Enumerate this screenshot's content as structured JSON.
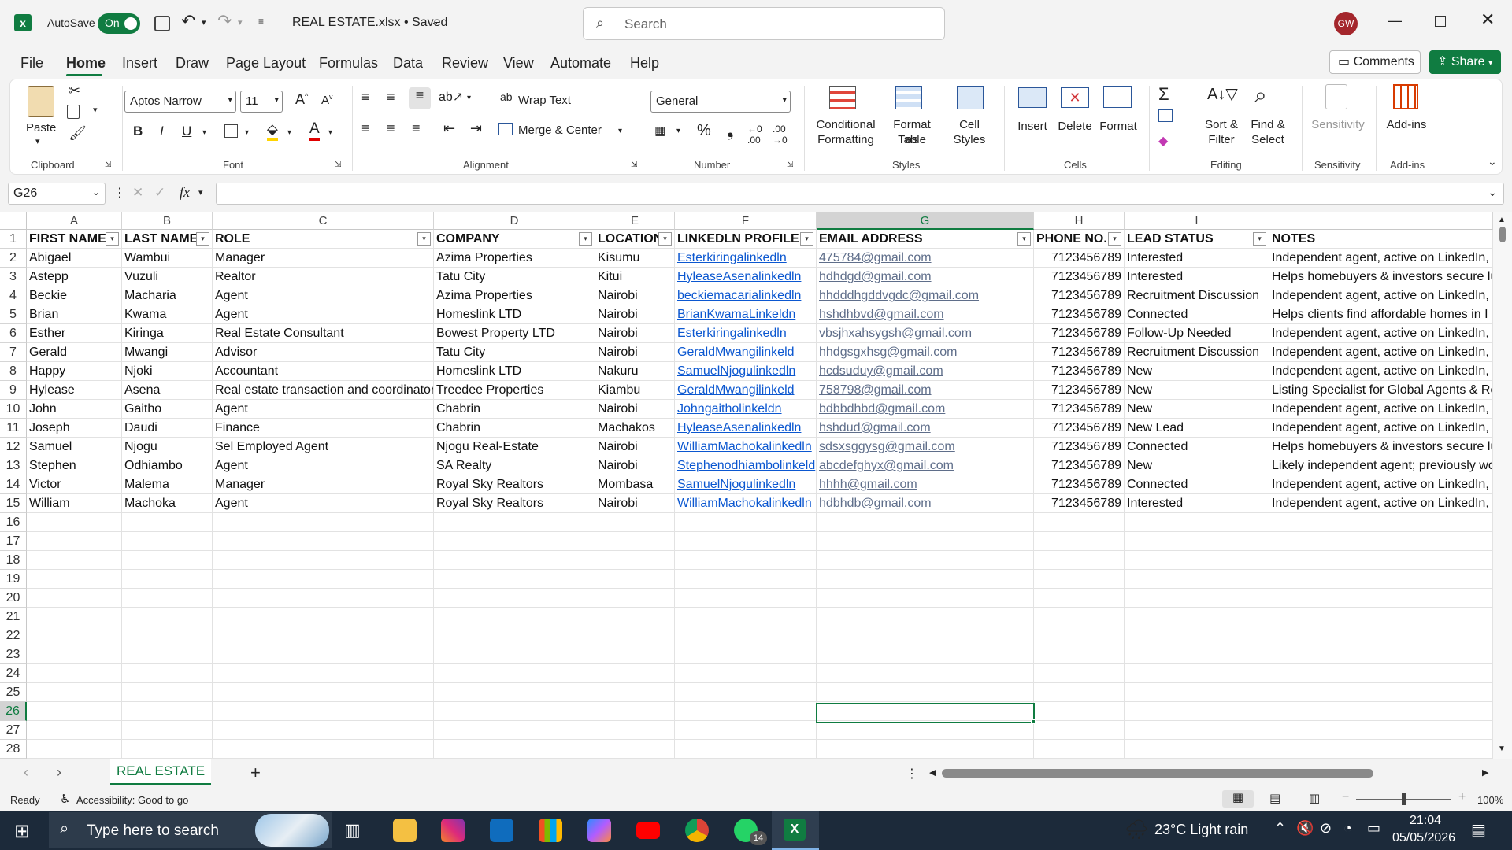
{
  "titlebar": {
    "autosave_label": "AutoSave",
    "autosave_state": "On",
    "filename": "REAL ESTATE.xlsx • Saved",
    "search_placeholder": "Search",
    "avatar_initials": "GW"
  },
  "menu": [
    "File",
    "Home",
    "Insert",
    "Draw",
    "Page Layout",
    "Formulas",
    "Data",
    "Review",
    "View",
    "Automate",
    "Help"
  ],
  "comments_label": "Comments",
  "share_label": "Share",
  "ribbon": {
    "paste": "Paste",
    "font_name": "Aptos Narrow",
    "font_size": "11",
    "wrap_text": "Wrap Text",
    "merge_center": "Merge & Center",
    "number_format": "General",
    "conditional": [
      "Conditional",
      "Formatting"
    ],
    "format_table": [
      "Format as",
      "Table"
    ],
    "cell_styles": [
      "Cell",
      "Styles"
    ],
    "insert": "Insert",
    "delete": "Delete",
    "format": "Format",
    "sort_filter": [
      "Sort &",
      "Filter"
    ],
    "find_select": [
      "Find &",
      "Select"
    ],
    "sensitivity": "Sensitivity",
    "addins": "Add-ins",
    "groups": [
      "Clipboard",
      "Font",
      "Alignment",
      "Number",
      "Styles",
      "Cells",
      "Editing",
      "Sensitivity",
      "Add-ins"
    ]
  },
  "formula": {
    "name_box": "G26",
    "fx": "fx"
  },
  "columns": [
    "A",
    "B",
    "C",
    "D",
    "E",
    "F",
    "G",
    "H",
    "I",
    ""
  ],
  "header_row": [
    "FIRST NAME",
    "LAST NAME",
    "ROLE",
    "COMPANY",
    "LOCATION",
    "LINKEDLN PROFILE",
    "EMAIL ADDRESS",
    "PHONE NO.",
    "LEAD STATUS",
    "NOTES"
  ],
  "rows": [
    [
      "Abigael",
      "Wambui",
      "Manager",
      "Azima Properties",
      "Kisumu",
      "Esterkiringalinkedln",
      "475784@gmail.com",
      "7123456789",
      "Interested",
      "Independent agent, active on LinkedIn, po"
    ],
    [
      "Astepp",
      "Vuzuli",
      "Realtor",
      "Tatu City",
      "Kitui",
      "HyleaseAsenalinkedln",
      "hdhdgd@gmail.com",
      "7123456789",
      "Interested",
      "Helps homebuyers & investors secure lu"
    ],
    [
      "Beckie",
      "Macharia",
      "Agent",
      "Azima Properties",
      "Nairobi",
      "beckiemacarialinkedln",
      "hhdddhgddvgdc@gmail.com",
      "7123456789",
      "Recruitment Discussion",
      "Independent agent, active on LinkedIn, po"
    ],
    [
      "Brian",
      "Kwama",
      "Agent",
      "Homeslink LTD",
      "Nairobi",
      "BrianKwamaLinkeldn",
      "hshdhbvd@gmail.com",
      "7123456789",
      "Connected",
      "Helps clients find affordable homes in I"
    ],
    [
      "Esther",
      "Kiringa",
      "Real Estate Consultant",
      "Bowest Property LTD",
      "Nairobi",
      "Esterkiringalinkedln",
      "vbsjhxahsygsh@gmail.com",
      "7123456789",
      "Follow-Up Needed",
      "Independent agent, active on LinkedIn, po"
    ],
    [
      "Gerald",
      "Mwangi",
      "Advisor",
      "Tatu City",
      "Nairobi",
      "GeraldMwangilinkeld",
      "hhdgsgxhsg@gmail.com",
      "7123456789",
      "Recruitment Discussion",
      "Independent agent, active on LinkedIn, po"
    ],
    [
      "Happy",
      "Njoki",
      "Accountant",
      "Homeslink LTD",
      "Nakuru",
      "SamuelNjogulinkedln",
      "hcdsuduy@gmail.com",
      "7123456789",
      "New",
      "Independent agent, active on LinkedIn, po"
    ],
    [
      "Hylease",
      "Asena",
      "Real estate transaction and coordinator",
      "Treedee Properties",
      "Kiambu",
      "GeraldMwangilinkeld",
      "758798@gmail.com",
      "7123456789",
      "New",
      "Listing Specialist for Global Agents & Real"
    ],
    [
      "John",
      "Gaitho",
      "Agent",
      "Chabrin",
      "Nairobi",
      "Johngaitholinkeldn",
      "bdbbdhbd@gmail.com",
      "7123456789",
      "New",
      "Independent agent, active on LinkedIn, po"
    ],
    [
      "Joseph",
      "Daudi",
      "Finance",
      "Chabrin",
      "Machakos",
      "HyleaseAsenalinkedln",
      "hshdud@gmail.com",
      "7123456789",
      "New Lead",
      "Independent agent, active on LinkedIn, po"
    ],
    [
      "Samuel",
      "Njogu",
      "Sel Employed Agent",
      "Njogu Real-Estate",
      "Nairobi",
      "WilliamMachokalinkedln",
      "sdsxsggysg@gmail.com",
      "7123456789",
      "Connected",
      "Helps homebuyers & investors secure lu"
    ],
    [
      "Stephen",
      "Odhiambo",
      "Agent",
      "SA  Realty",
      "Nairobi",
      "Stephenodhiambolinkeld",
      "abcdefghyx@gmail.com",
      "7123456789",
      "New",
      "Likely independent agent; previously work"
    ],
    [
      "Victor",
      "Malema",
      "Manager",
      "Royal Sky Realtors",
      "Mombasa",
      "SamuelNjogulinkedln",
      "hhhh@gmail.com",
      "7123456789",
      "Connected",
      "Independent agent, active on LinkedIn, po"
    ],
    [
      "William",
      "Machoka",
      "Agent",
      "Royal Sky Realtors",
      "Nairobi",
      "WilliamMachokalinkedln",
      "hdbhdb@gmail.com",
      "7123456789",
      "Interested",
      "Independent agent, active on LinkedIn, po"
    ]
  ],
  "row_numbers": [
    "1",
    "2",
    "3",
    "4",
    "5",
    "6",
    "7",
    "8",
    "9",
    "10",
    "11",
    "12",
    "13",
    "14",
    "15",
    "16",
    "17",
    "18",
    "19",
    "20",
    "21",
    "22",
    "23",
    "24",
    "25",
    "26",
    "27",
    "28"
  ],
  "sheet_tab": "REAL ESTATE",
  "status": {
    "ready": "Ready",
    "accessibility": "Accessibility: Good to go",
    "zoom": "100%"
  },
  "taskbar": {
    "search_placeholder": "Type here to search",
    "weather": "23°C  Light rain",
    "time": "21:04",
    "date": "05/05/2026",
    "whatsapp_badge": "14"
  },
  "colors": {
    "excel_green": "#107c41",
    "link_blue": "#0b57d0",
    "taskbar": "#1c2a3a",
    "selection": "#107c41"
  }
}
